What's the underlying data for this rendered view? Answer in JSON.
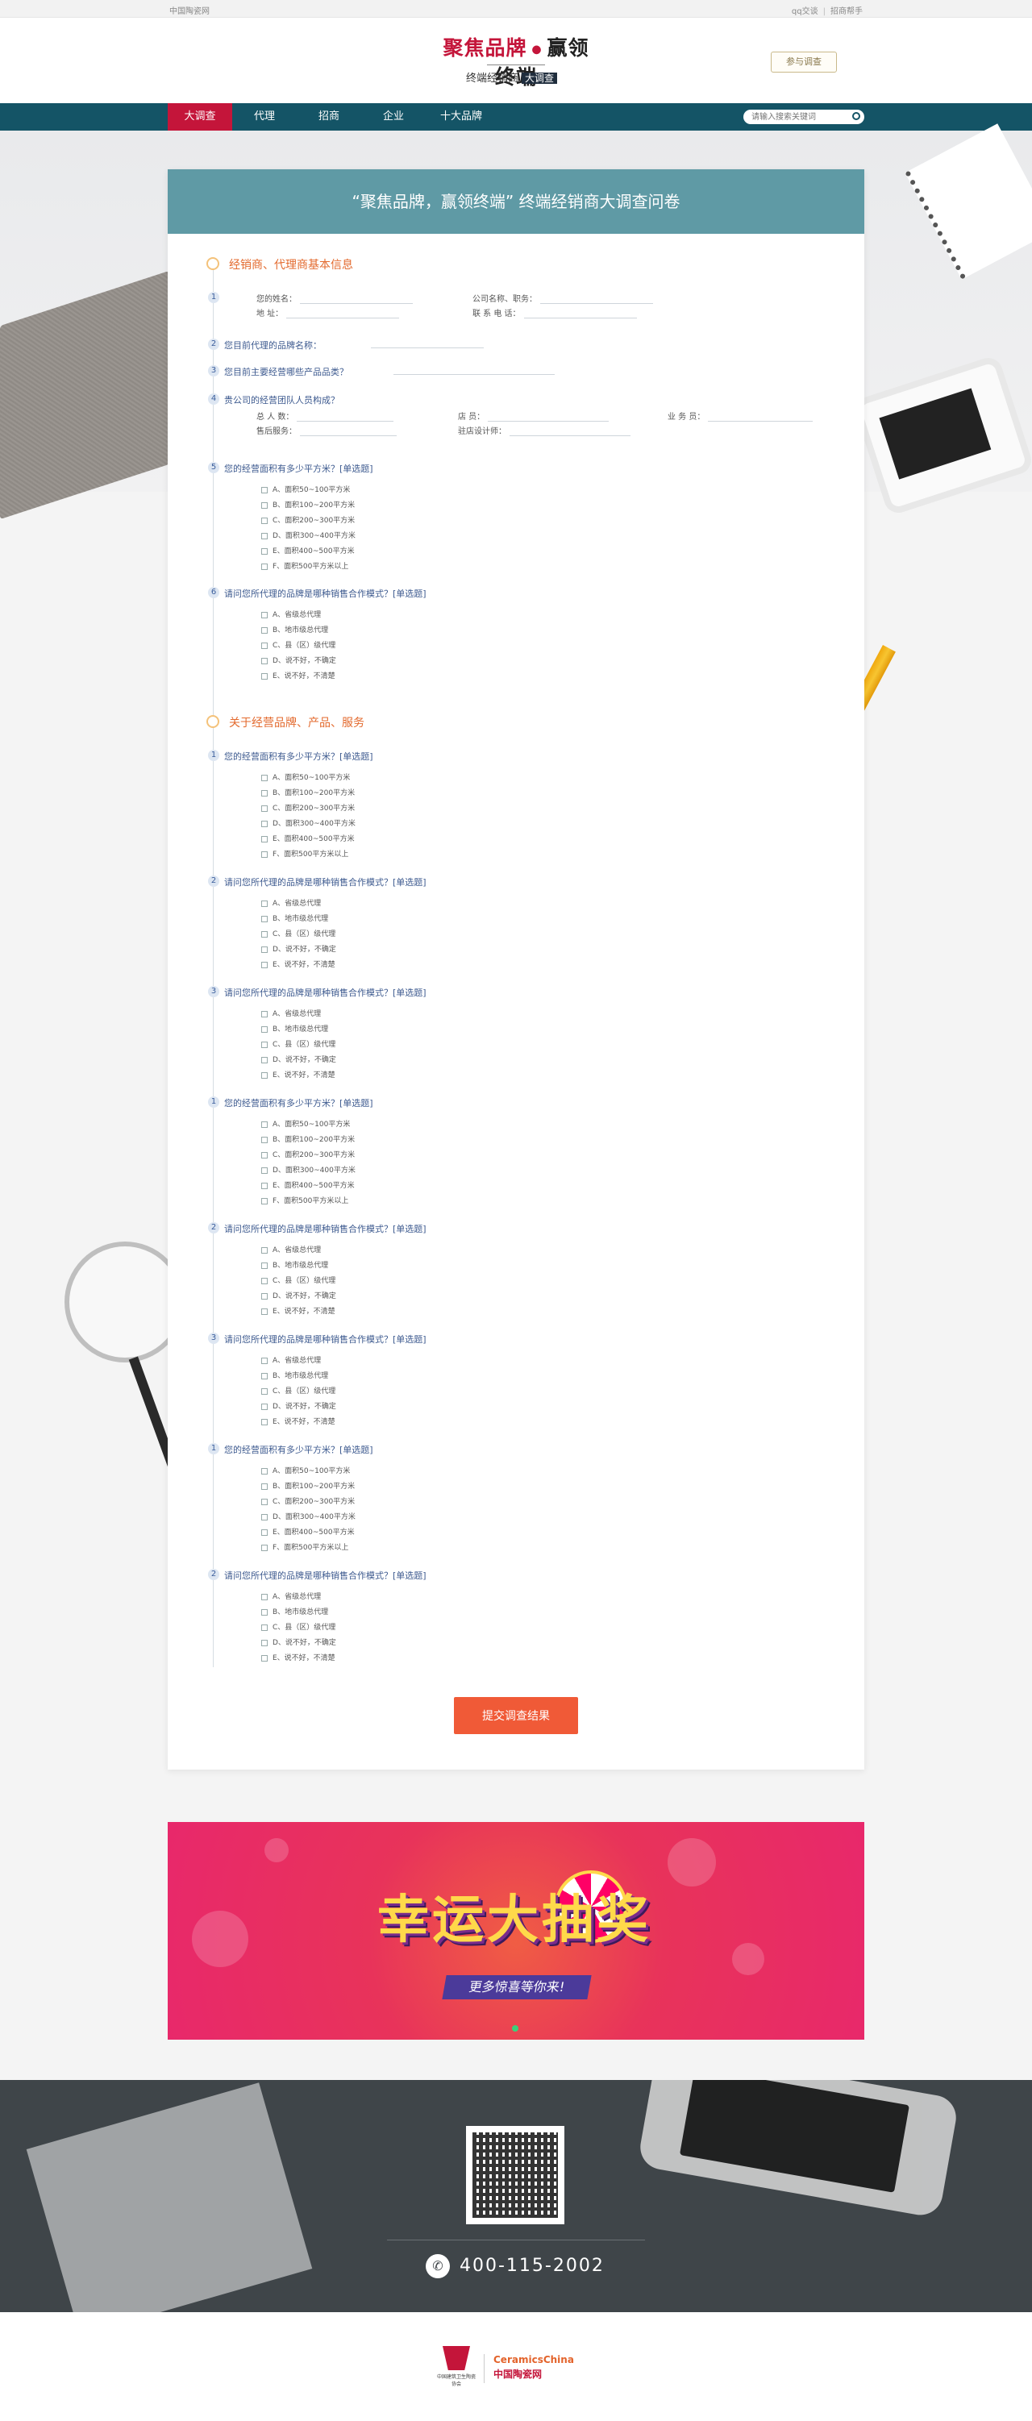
{
  "topbar": {
    "left": "中国陶瓷网",
    "right_1": "qq交谈",
    "right_2": "招商帮手"
  },
  "header": {
    "logo_part1": "聚焦品牌",
    "logo_part2": "赢领终端",
    "logo_sub": "终端经销商",
    "logo_tag": "大调查",
    "join_label": "参与调查"
  },
  "nav": {
    "items": [
      {
        "label": "大调查"
      },
      {
        "label": "代理"
      },
      {
        "label": "招商"
      },
      {
        "label": "企业"
      },
      {
        "label": "十大品牌"
      }
    ],
    "search_placeholder": "请输入搜索关键词"
  },
  "card": {
    "title": "“聚焦品牌，赢领终端” 终端经销商大调查问卷",
    "sections": [
      {
        "title": "经销商、代理商基本信息"
      },
      {
        "title": "关于经营品牌、产品、服务"
      }
    ],
    "basic": {
      "q1": "您的姓名：",
      "addr": "地 址：",
      "company": "公司名称、职务：",
      "phone": "联 系 电 话：",
      "q2": "您目前代理的品牌名称：",
      "q3": "您目前主要经营哪些产品品类？",
      "q4": "贵公司的经营团队人员构成？",
      "q4_f1": "总 人 数：",
      "q4_f2": "店 员：",
      "q4_f3": "业 务 员：",
      "q4_f4": "售后服务：",
      "q4_f5": "驻店设计师："
    },
    "q_area": "您的经营面积有多少平方米？[单选题]",
    "q_mode": "请问您所代理的品牌是哪种销售合作模式？[单选题]",
    "area_options": [
      "A、面积50~100平方米",
      "B、面积100~200平方米",
      "C、面积200~300平方米",
      "D、面积300~400平方米",
      "E、面积400~500平方米",
      "F、面积500平方米以上"
    ],
    "mode_options": [
      "A、省级总代理",
      "B、地市级总代理",
      "C、县（区）级代理",
      "D、说不好，不确定",
      "E、说不好，不清楚"
    ],
    "nums": [
      "1",
      "2",
      "3",
      "4",
      "5",
      "6"
    ],
    "submit_label": "提交调查结果"
  },
  "banner": {
    "headline": "幸运大抽奖",
    "subline": "更多惊喜等你来!"
  },
  "footer": {
    "tel": "400-115-2002",
    "phone_icon": "phone-icon"
  },
  "bottom": {
    "logo1_caption": "中国建筑卫生陶瓷协会",
    "logo2_en": "CeramicsChina",
    "logo2_cn": "中国陶瓷网"
  },
  "colors": {
    "brand_red": "#c4153a",
    "nav_teal": "#145466",
    "card_head": "#5f9aa5",
    "submit": "#f05a37",
    "section_orange": "#e36a2e"
  }
}
